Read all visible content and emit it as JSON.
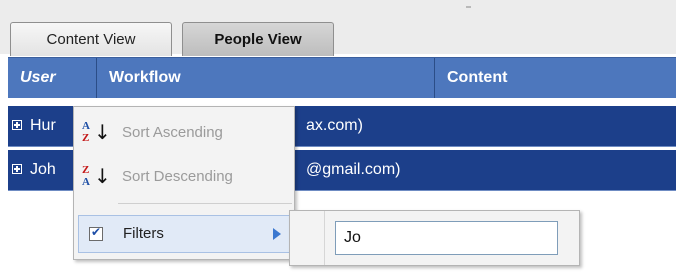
{
  "tabs": [
    {
      "label": "Content View",
      "active": false
    },
    {
      "label": "People View",
      "active": true
    }
  ],
  "table": {
    "columns": [
      "User",
      "Workflow",
      "Content"
    ],
    "rows": [
      {
        "name": "Hur",
        "email_fragment": "ax.com)"
      },
      {
        "name": "Joh",
        "email_fragment": "@gmail.com)"
      }
    ]
  },
  "context_menu": {
    "items": [
      {
        "label": "Sort Ascending",
        "icon": "sort-ascending-icon",
        "icon_letters": [
          "A",
          "Z"
        ],
        "enabled": false
      },
      {
        "label": "Sort Descending",
        "icon": "sort-descending-icon",
        "icon_letters": [
          "Z",
          "A"
        ],
        "enabled": false
      },
      {
        "label": "Filters",
        "icon": "checkbox",
        "checked": true,
        "has_submenu": true
      }
    ]
  },
  "filter_submenu": {
    "input_value": "Jo"
  },
  "colors": {
    "header_bg": "#4d77bd",
    "row_bg": "#1c3f8a",
    "menu_bg": "#f3f3f3",
    "highlight": "#e1eaf7"
  }
}
